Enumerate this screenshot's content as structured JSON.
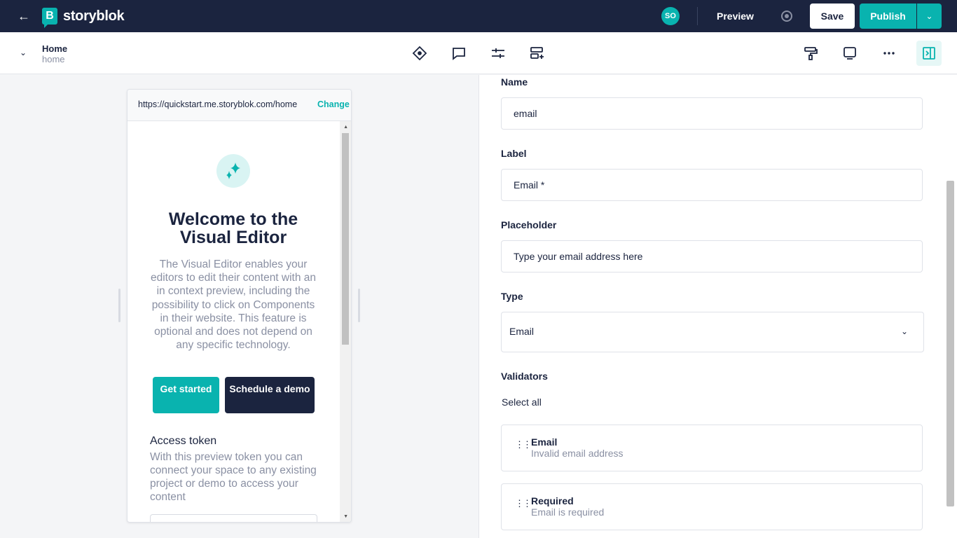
{
  "topbar": {
    "logo_text": "storyblok",
    "logo_letter": "B",
    "avatar_initials": "SO",
    "preview_label": "Preview",
    "save_label": "Save",
    "publish_label": "Publish"
  },
  "story": {
    "title": "Home",
    "slug": "home"
  },
  "preview": {
    "url": "https://quickstart.me.storyblok.com/home",
    "change_label": "Change U",
    "welcome_title": "Welcome to the Visual Editor",
    "welcome_desc": "The Visual Editor enables your editors to edit their content with an in context preview, including the possibility to click on Components in their website. This feature is optional and does not depend on any specific technology.",
    "get_started_label": "Get started",
    "schedule_demo_label": "Schedule a demo",
    "access_token_title": "Access token",
    "access_token_desc": "With this preview token you can connect your space to any existing project or demo to access your content"
  },
  "form": {
    "name_label": "Name",
    "name_value": "email",
    "label_label": "Label",
    "label_value": "Email *",
    "placeholder_label": "Placeholder",
    "placeholder_value": "Type your email address here",
    "type_label": "Type",
    "type_value": "Email",
    "validators_label": "Validators",
    "select_all_label": "Select all",
    "validators": [
      {
        "name": "Email",
        "message": "Invalid email address"
      },
      {
        "name": "Required",
        "message": "Email is required"
      }
    ]
  },
  "colors": {
    "navy": "#1b243f",
    "teal": "#09b3af"
  }
}
